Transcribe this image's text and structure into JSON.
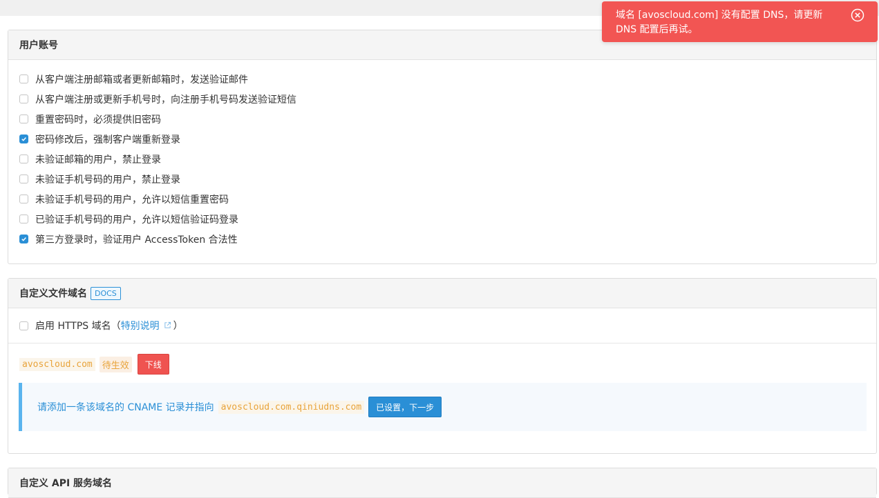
{
  "toast": {
    "message": "域名 [avoscloud.com] 没有配置 DNS，请更新 DNS 配置后再试。",
    "close_icon": "close-circle-icon"
  },
  "user_accounts": {
    "title": "用户账号",
    "options": [
      {
        "label": "从客户端注册邮箱或者更新邮箱时，发送验证邮件",
        "checked": false
      },
      {
        "label": "从客户端注册或更新手机号时，向注册手机号码发送验证短信",
        "checked": false
      },
      {
        "label": "重置密码时，必须提供旧密码",
        "checked": false
      },
      {
        "label": "密码修改后，强制客户端重新登录",
        "checked": true
      },
      {
        "label": "未验证邮箱的用户，禁止登录",
        "checked": false
      },
      {
        "label": "未验证手机号码的用户，禁止登录",
        "checked": false
      },
      {
        "label": "未验证手机号码的用户，允许以短信重置密码",
        "checked": false
      },
      {
        "label": "已验证手机号码的用户，允许以短信验证码登录",
        "checked": false
      },
      {
        "label": "第三方登录时，验证用户 AccessToken 合法性",
        "checked": true
      }
    ]
  },
  "custom_file_domain": {
    "title": "自定义文件域名",
    "docs_label": "DOCS",
    "https": {
      "label_prefix": "启用 HTTPS 域名（",
      "link": "特别说明",
      "label_suffix": "）",
      "checked": false
    },
    "domain": "avoscloud.com",
    "status": "待生效",
    "offline_button": "下线",
    "cname_instruction": "请添加一条该域名的 CNAME 记录并指向",
    "cname_target": "avoscloud.com.qiniudns.com",
    "next_button": "已设置，下一步"
  },
  "next_section": {
    "title": "自定义 API 服务域名"
  },
  "colors": {
    "accent": "#2a8fd6",
    "error": "#f25553",
    "warning": "#e8a33a"
  }
}
